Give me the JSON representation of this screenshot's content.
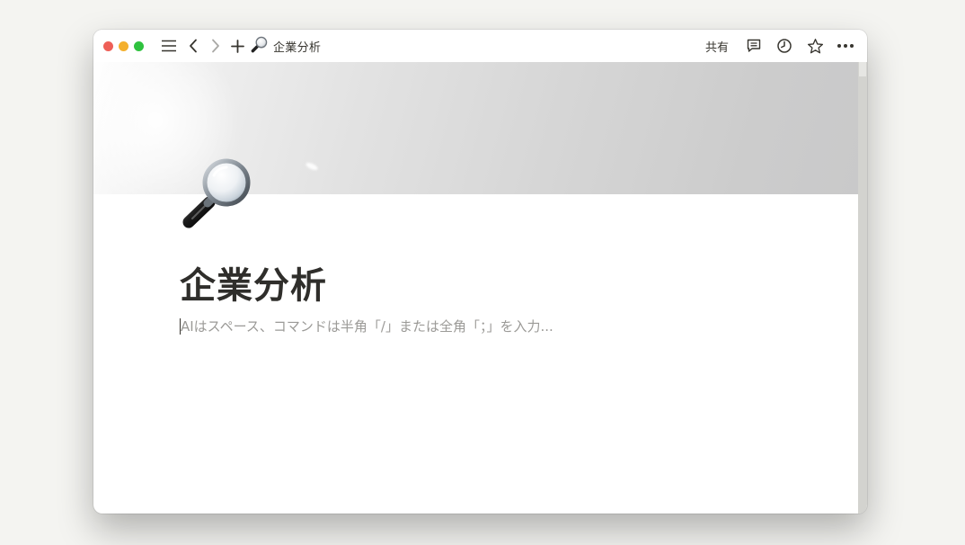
{
  "window": {
    "traffic_lights": [
      "close",
      "minimize",
      "zoom"
    ]
  },
  "toolbar": {
    "breadcrumb_icon": "magnifier-emoji",
    "breadcrumb_title": "企業分析",
    "share_label": "共有",
    "icons": [
      "sidebar-menu-icon",
      "back-arrow-icon",
      "forward-arrow-icon",
      "plus-icon",
      "comment-icon",
      "clock-icon",
      "star-icon",
      "more-icon"
    ]
  },
  "page": {
    "icon": "magnifying-glass",
    "title": "企業分析",
    "placeholder": "AIはスペース、コマンドは半角「/」または全角「；」を入力..."
  },
  "colors": {
    "text": "#37352f",
    "placeholder": "#9b9a97",
    "close": "#ee5f57",
    "minimize": "#f4b02e",
    "zoom": "#2fc23f"
  }
}
